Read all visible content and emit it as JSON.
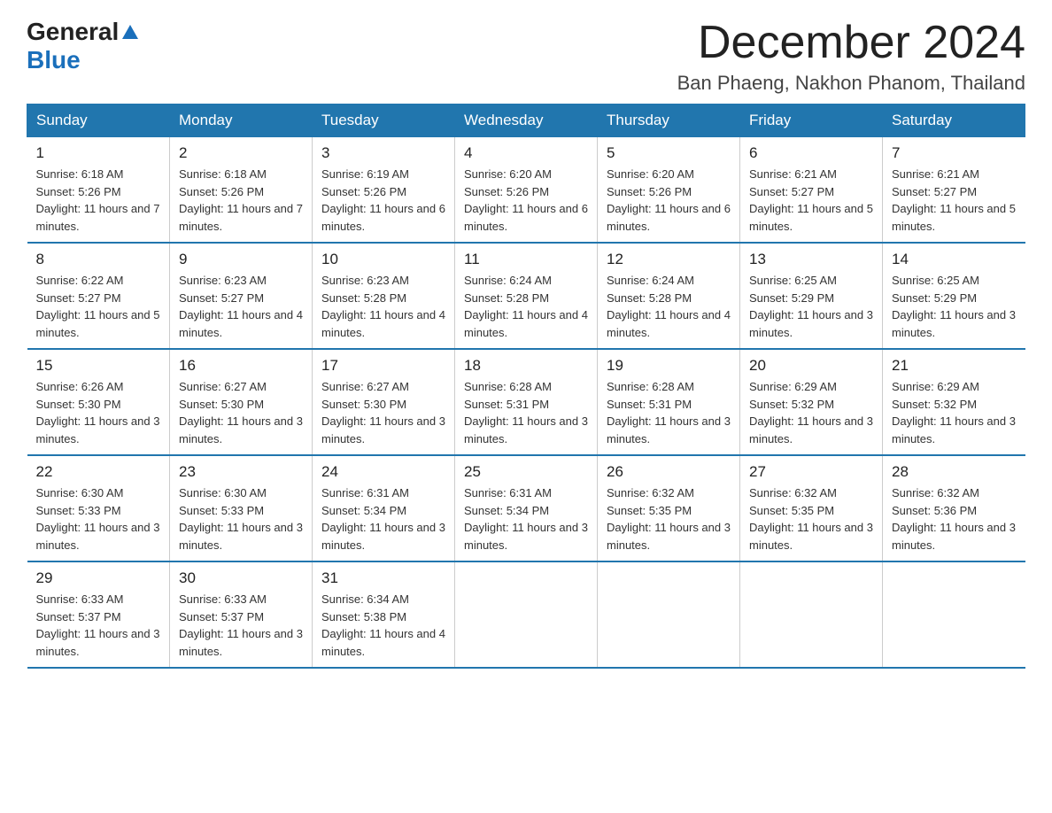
{
  "header": {
    "logo_general": "General",
    "logo_blue": "Blue",
    "title": "December 2024",
    "subtitle": "Ban Phaeng, Nakhon Phanom, Thailand"
  },
  "days_of_week": [
    "Sunday",
    "Monday",
    "Tuesday",
    "Wednesday",
    "Thursday",
    "Friday",
    "Saturday"
  ],
  "weeks": [
    [
      {
        "day": "1",
        "sunrise": "6:18 AM",
        "sunset": "5:26 PM",
        "daylight": "11 hours and 7 minutes."
      },
      {
        "day": "2",
        "sunrise": "6:18 AM",
        "sunset": "5:26 PM",
        "daylight": "11 hours and 7 minutes."
      },
      {
        "day": "3",
        "sunrise": "6:19 AM",
        "sunset": "5:26 PM",
        "daylight": "11 hours and 6 minutes."
      },
      {
        "day": "4",
        "sunrise": "6:20 AM",
        "sunset": "5:26 PM",
        "daylight": "11 hours and 6 minutes."
      },
      {
        "day": "5",
        "sunrise": "6:20 AM",
        "sunset": "5:26 PM",
        "daylight": "11 hours and 6 minutes."
      },
      {
        "day": "6",
        "sunrise": "6:21 AM",
        "sunset": "5:27 PM",
        "daylight": "11 hours and 5 minutes."
      },
      {
        "day": "7",
        "sunrise": "6:21 AM",
        "sunset": "5:27 PM",
        "daylight": "11 hours and 5 minutes."
      }
    ],
    [
      {
        "day": "8",
        "sunrise": "6:22 AM",
        "sunset": "5:27 PM",
        "daylight": "11 hours and 5 minutes."
      },
      {
        "day": "9",
        "sunrise": "6:23 AM",
        "sunset": "5:27 PM",
        "daylight": "11 hours and 4 minutes."
      },
      {
        "day": "10",
        "sunrise": "6:23 AM",
        "sunset": "5:28 PM",
        "daylight": "11 hours and 4 minutes."
      },
      {
        "day": "11",
        "sunrise": "6:24 AM",
        "sunset": "5:28 PM",
        "daylight": "11 hours and 4 minutes."
      },
      {
        "day": "12",
        "sunrise": "6:24 AM",
        "sunset": "5:28 PM",
        "daylight": "11 hours and 4 minutes."
      },
      {
        "day": "13",
        "sunrise": "6:25 AM",
        "sunset": "5:29 PM",
        "daylight": "11 hours and 3 minutes."
      },
      {
        "day": "14",
        "sunrise": "6:25 AM",
        "sunset": "5:29 PM",
        "daylight": "11 hours and 3 minutes."
      }
    ],
    [
      {
        "day": "15",
        "sunrise": "6:26 AM",
        "sunset": "5:30 PM",
        "daylight": "11 hours and 3 minutes."
      },
      {
        "day": "16",
        "sunrise": "6:27 AM",
        "sunset": "5:30 PM",
        "daylight": "11 hours and 3 minutes."
      },
      {
        "day": "17",
        "sunrise": "6:27 AM",
        "sunset": "5:30 PM",
        "daylight": "11 hours and 3 minutes."
      },
      {
        "day": "18",
        "sunrise": "6:28 AM",
        "sunset": "5:31 PM",
        "daylight": "11 hours and 3 minutes."
      },
      {
        "day": "19",
        "sunrise": "6:28 AM",
        "sunset": "5:31 PM",
        "daylight": "11 hours and 3 minutes."
      },
      {
        "day": "20",
        "sunrise": "6:29 AM",
        "sunset": "5:32 PM",
        "daylight": "11 hours and 3 minutes."
      },
      {
        "day": "21",
        "sunrise": "6:29 AM",
        "sunset": "5:32 PM",
        "daylight": "11 hours and 3 minutes."
      }
    ],
    [
      {
        "day": "22",
        "sunrise": "6:30 AM",
        "sunset": "5:33 PM",
        "daylight": "11 hours and 3 minutes."
      },
      {
        "day": "23",
        "sunrise": "6:30 AM",
        "sunset": "5:33 PM",
        "daylight": "11 hours and 3 minutes."
      },
      {
        "day": "24",
        "sunrise": "6:31 AM",
        "sunset": "5:34 PM",
        "daylight": "11 hours and 3 minutes."
      },
      {
        "day": "25",
        "sunrise": "6:31 AM",
        "sunset": "5:34 PM",
        "daylight": "11 hours and 3 minutes."
      },
      {
        "day": "26",
        "sunrise": "6:32 AM",
        "sunset": "5:35 PM",
        "daylight": "11 hours and 3 minutes."
      },
      {
        "day": "27",
        "sunrise": "6:32 AM",
        "sunset": "5:35 PM",
        "daylight": "11 hours and 3 minutes."
      },
      {
        "day": "28",
        "sunrise": "6:32 AM",
        "sunset": "5:36 PM",
        "daylight": "11 hours and 3 minutes."
      }
    ],
    [
      {
        "day": "29",
        "sunrise": "6:33 AM",
        "sunset": "5:37 PM",
        "daylight": "11 hours and 3 minutes."
      },
      {
        "day": "30",
        "sunrise": "6:33 AM",
        "sunset": "5:37 PM",
        "daylight": "11 hours and 3 minutes."
      },
      {
        "day": "31",
        "sunrise": "6:34 AM",
        "sunset": "5:38 PM",
        "daylight": "11 hours and 4 minutes."
      },
      null,
      null,
      null,
      null
    ]
  ],
  "labels": {
    "sunrise_prefix": "Sunrise: ",
    "sunset_prefix": "Sunset: ",
    "daylight_prefix": "Daylight: "
  }
}
